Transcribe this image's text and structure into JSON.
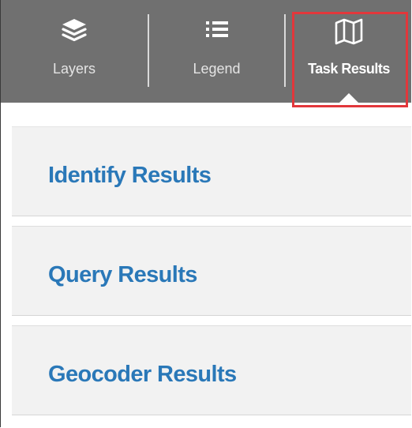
{
  "tabs": {
    "layers_label": "Layers",
    "legend_label": "Legend",
    "results_label": "Task Results",
    "active": "Task Results"
  },
  "results": {
    "identify_label": "Identify Results",
    "query_label": "Query Results",
    "geocoder_label": "Geocoder Results"
  },
  "colors": {
    "tab_bar": "#707070",
    "link": "#2a78b8",
    "highlight": "#e2373b",
    "panel": "#f2f2f2"
  },
  "icons": {
    "layers": "layers-stack-icon",
    "legend": "list-icon",
    "results": "map-icon"
  }
}
